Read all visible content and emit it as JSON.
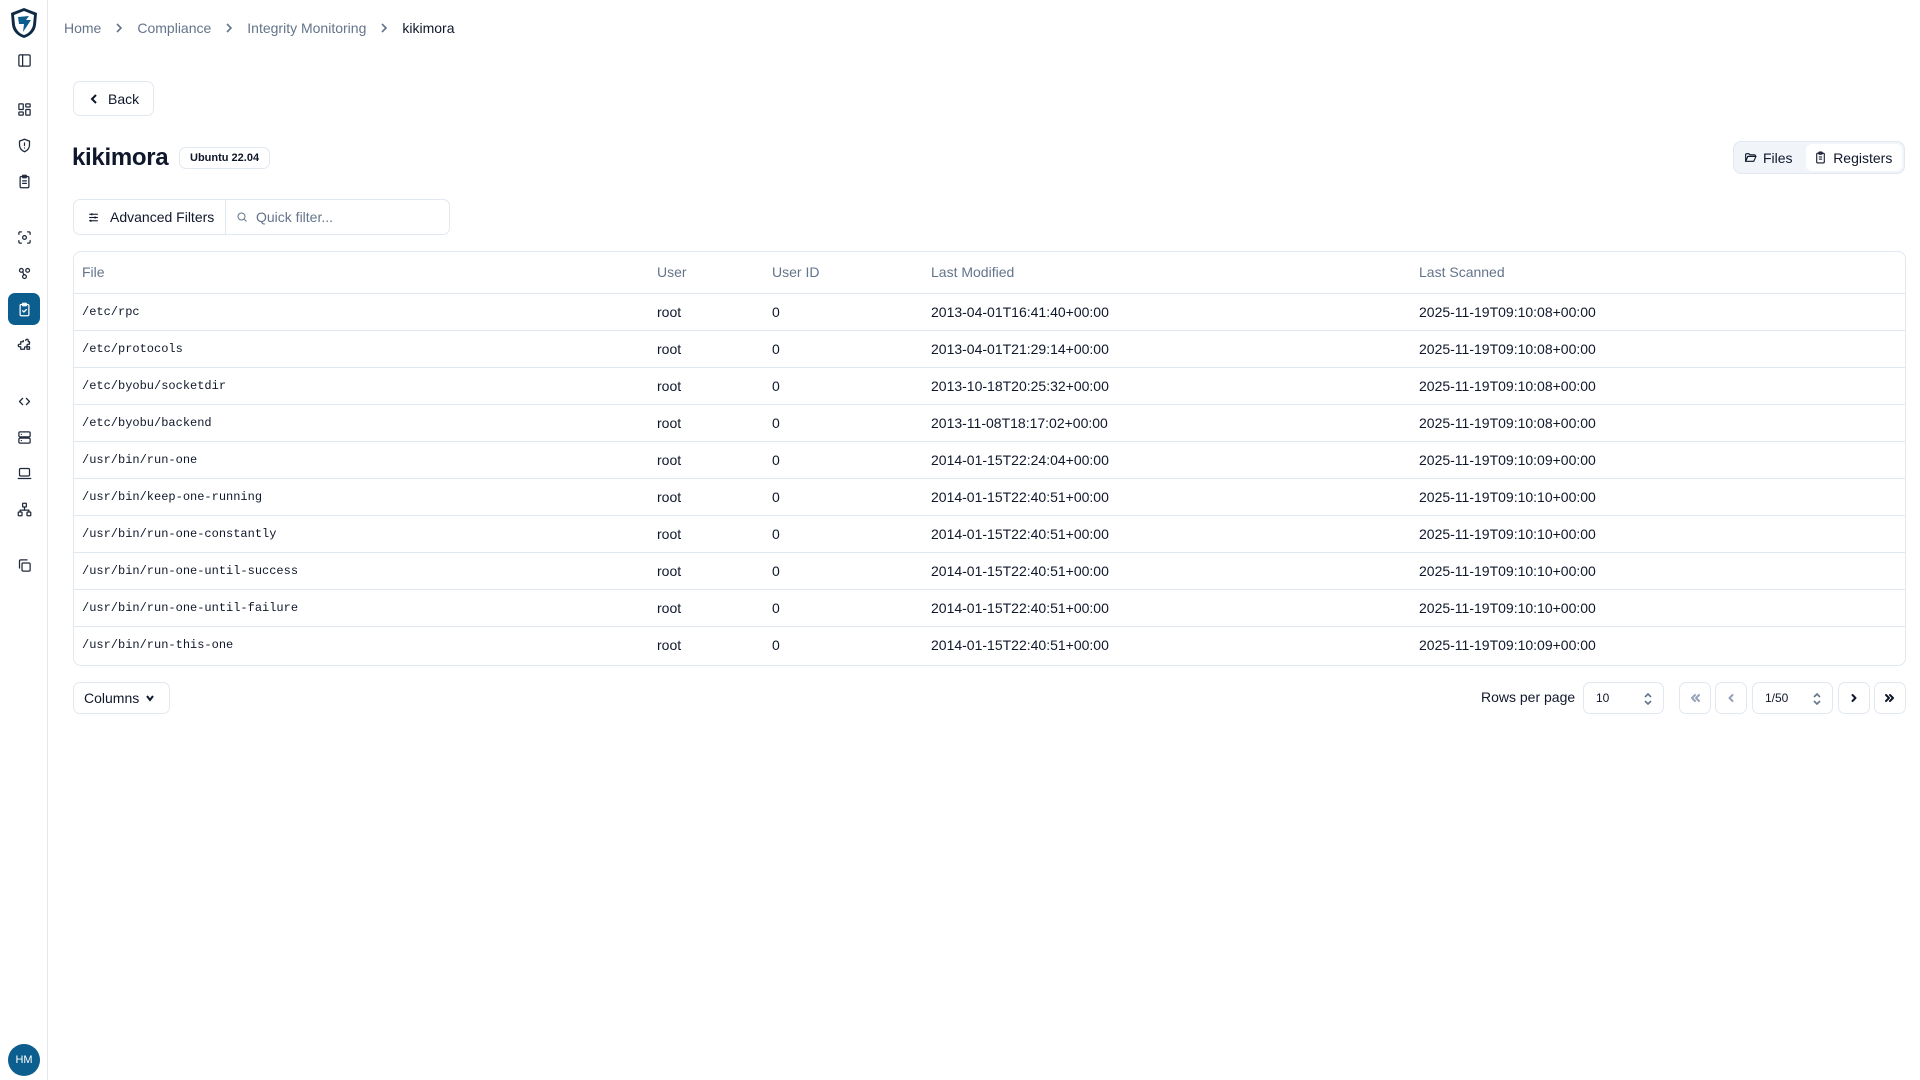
{
  "sidebar": {
    "logo": "shield-logo",
    "items": [
      {
        "name": "toggle-sidebar-icon"
      },
      {
        "name": "dashboard-icon"
      },
      {
        "name": "shield-alert-icon"
      },
      {
        "name": "clipboard-list-icon"
      },
      {
        "name": "scan-icon"
      },
      {
        "name": "nodes-icon"
      },
      {
        "name": "clipboard-check-icon",
        "active": true
      },
      {
        "name": "puzzle-icon"
      },
      {
        "name": "code-icon"
      },
      {
        "name": "server-icon"
      },
      {
        "name": "laptop-icon"
      },
      {
        "name": "network-icon"
      },
      {
        "name": "copy-icon"
      }
    ],
    "avatar_initials": "HM"
  },
  "breadcrumb": {
    "items": [
      "Home",
      "Compliance",
      "Integrity Monitoring"
    ],
    "current": "kikimora"
  },
  "back_button": {
    "label": "Back"
  },
  "page": {
    "title": "kikimora",
    "os_badge": "Ubuntu 22.04"
  },
  "view_toggle": {
    "files_label": "Files",
    "registers_label": "Registers"
  },
  "filters": {
    "advanced_label": "Advanced Filters",
    "quick_placeholder": "Quick filter..."
  },
  "table": {
    "headers": {
      "file": "File",
      "user": "User",
      "user_id": "User ID",
      "last_modified": "Last Modified",
      "last_scanned": "Last Scanned"
    },
    "rows": [
      {
        "file": "/etc/rpc",
        "user": "root",
        "user_id": "0",
        "last_modified": "2013-04-01T16:41:40+00:00",
        "last_scanned": "2025-11-19T09:10:08+00:00"
      },
      {
        "file": "/etc/protocols",
        "user": "root",
        "user_id": "0",
        "last_modified": "2013-04-01T21:29:14+00:00",
        "last_scanned": "2025-11-19T09:10:08+00:00"
      },
      {
        "file": "/etc/byobu/socketdir",
        "user": "root",
        "user_id": "0",
        "last_modified": "2013-10-18T20:25:32+00:00",
        "last_scanned": "2025-11-19T09:10:08+00:00"
      },
      {
        "file": "/etc/byobu/backend",
        "user": "root",
        "user_id": "0",
        "last_modified": "2013-11-08T18:17:02+00:00",
        "last_scanned": "2025-11-19T09:10:08+00:00"
      },
      {
        "file": "/usr/bin/run-one",
        "user": "root",
        "user_id": "0",
        "last_modified": "2014-01-15T22:24:04+00:00",
        "last_scanned": "2025-11-19T09:10:09+00:00"
      },
      {
        "file": "/usr/bin/keep-one-running",
        "user": "root",
        "user_id": "0",
        "last_modified": "2014-01-15T22:40:51+00:00",
        "last_scanned": "2025-11-19T09:10:10+00:00"
      },
      {
        "file": "/usr/bin/run-one-constantly",
        "user": "root",
        "user_id": "0",
        "last_modified": "2014-01-15T22:40:51+00:00",
        "last_scanned": "2025-11-19T09:10:10+00:00"
      },
      {
        "file": "/usr/bin/run-one-until-success",
        "user": "root",
        "user_id": "0",
        "last_modified": "2014-01-15T22:40:51+00:00",
        "last_scanned": "2025-11-19T09:10:10+00:00"
      },
      {
        "file": "/usr/bin/run-one-until-failure",
        "user": "root",
        "user_id": "0",
        "last_modified": "2014-01-15T22:40:51+00:00",
        "last_scanned": "2025-11-19T09:10:10+00:00"
      },
      {
        "file": "/usr/bin/run-this-one",
        "user": "root",
        "user_id": "0",
        "last_modified": "2014-01-15T22:40:51+00:00",
        "last_scanned": "2025-11-19T09:10:09+00:00"
      }
    ]
  },
  "footer": {
    "columns_label": "Columns",
    "rows_per_page_label": "Rows per page",
    "rows_per_page_value": "10",
    "page_value": "1/50"
  },
  "colors": {
    "accent": "#0b5e8e",
    "border": "#e2e8f0",
    "muted_text": "#64748b",
    "text": "#0f172a"
  }
}
